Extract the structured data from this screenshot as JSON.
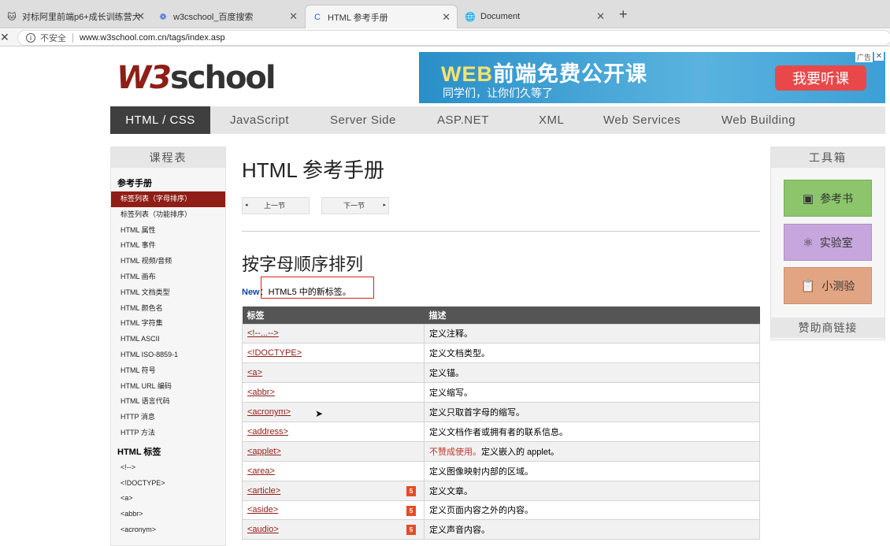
{
  "browser": {
    "tabs": [
      {
        "title": "对标阿里前端p6+成长训练营大..."
      },
      {
        "title": "w3cschool_百度搜索"
      },
      {
        "title": "HTML 参考手册"
      },
      {
        "title": "Document"
      }
    ],
    "new_tab": "+",
    "security_label": "不安全",
    "url": "www.w3school.com.cn/tags/index.asp"
  },
  "site": {
    "logo_w3": "W3",
    "logo_school": "school",
    "banner": {
      "web": "WEB",
      "title_rest": "前端免费公开课",
      "subtitle": "同学们，让你们久等了",
      "button": "我要听课",
      "ad_tag": "广告",
      "close": "✕"
    },
    "nav": [
      "HTML / CSS",
      "JavaScript",
      "Server Side",
      "ASP.NET",
      "XML",
      "Web Services",
      "Web Building"
    ]
  },
  "left_panel": {
    "title": "课程表",
    "section1": "参考手册",
    "items1": [
      "标签列表（字母排序）",
      "标签列表（功能排序）",
      "HTML 属性",
      "HTML 事件",
      "HTML 视频/音频",
      "HTML 画布",
      "HTML 文档类型",
      "HTML 颜色名",
      "HTML 字符集",
      "HTML ASCII",
      "HTML ISO-8859-1",
      "HTML 符号",
      "HTML URL 编码",
      "HTML 语言代码",
      "HTTP 消息",
      "HTTP 方法"
    ],
    "section2": "HTML 标签",
    "items2": [
      "<!-->",
      "<!DOCTYPE>",
      "<a>",
      "<abbr>",
      "<acronym>"
    ]
  },
  "main": {
    "title": "HTML 参考手册",
    "prev": "上一节",
    "next": "下一节",
    "subtitle": "按字母顺序排列",
    "new_label": "New",
    "new_text": "：HTML5 中的新标签。",
    "headers": [
      "标签",
      "描述"
    ],
    "rows": [
      {
        "tag": "<!--...-->",
        "desc": "定义注释。"
      },
      {
        "tag": "<!DOCTYPE>",
        "desc": "定义文档类型。"
      },
      {
        "tag": "<a>",
        "desc": "定义锚。"
      },
      {
        "tag": "<abbr>",
        "desc": "定义缩写。"
      },
      {
        "tag": "<acronym>",
        "desc": "定义只取首字母的缩写。"
      },
      {
        "tag": "<address>",
        "desc": "定义文档作者或拥有者的联系信息。"
      },
      {
        "tag": "<applet>",
        "deprecated": "不赞成使用。",
        "desc": "定义嵌入的 applet。"
      },
      {
        "tag": "<area>",
        "desc": "定义图像映射内部的区域。"
      },
      {
        "tag": "<article>",
        "desc": "定义文章。",
        "html5": "5"
      },
      {
        "tag": "<aside>",
        "desc": "定义页面内容之外的内容。",
        "html5": "5"
      },
      {
        "tag": "<audio>",
        "desc": "定义声音内容。",
        "html5": "5"
      }
    ]
  },
  "right_panel": {
    "title": "工具箱",
    "buttons": [
      {
        "label": "参考书",
        "color": "#8cc56b"
      },
      {
        "label": "实验室",
        "color": "#c6a6dc"
      },
      {
        "label": "小测验",
        "color": "#e2a584"
      }
    ],
    "sponsor": "赞助商链接"
  },
  "colors": {
    "brand": "#8e1e16",
    "nav_active": "#3f3f3f",
    "table_header": "#555555"
  }
}
